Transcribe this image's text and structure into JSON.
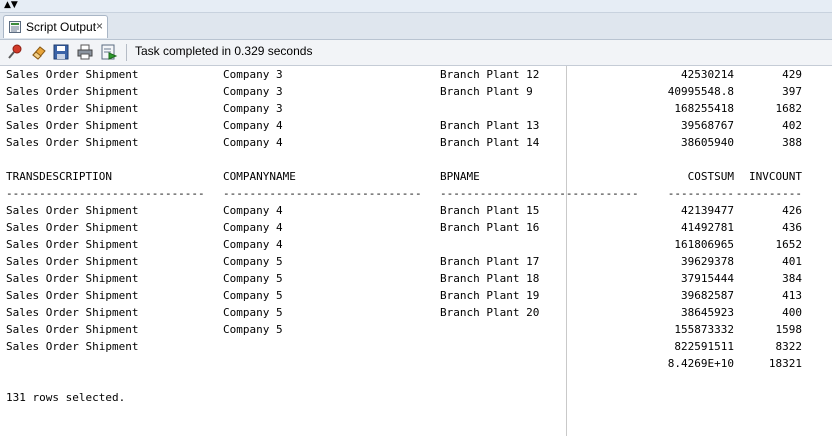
{
  "window": {
    "tab_title": "Script Output",
    "tab_close": "×",
    "collapse_icon": "▲▼"
  },
  "toolbar": {
    "buttons": [
      "pin-icon",
      "eraser-icon",
      "save-icon",
      "print-icon",
      "run-script-icon"
    ],
    "status": "Task completed in 0.329 seconds"
  },
  "output": {
    "header": {
      "c1": "TRANSDESCRIPTION",
      "c2": "COMPANYNAME",
      "c3": "BPNAME",
      "c4": "COSTSUM",
      "c5": "INVCOUNT"
    },
    "dashes": {
      "c1": "------------------------------",
      "c2": "------------------------------",
      "c3": "------------------------------",
      "c4": "----------",
      "c5": "----------"
    },
    "rows_before": [
      {
        "c1": "Sales Order Shipment",
        "c2": "Company 3",
        "c3": "Branch Plant 12",
        "c4": "42530214",
        "c5": "429"
      },
      {
        "c1": "Sales Order Shipment",
        "c2": "Company 3",
        "c3": "Branch Plant 9",
        "c4": "40995548.8",
        "c5": "397"
      },
      {
        "c1": "Sales Order Shipment",
        "c2": "Company 3",
        "c3": "",
        "c4": "168255418",
        "c5": "1682"
      },
      {
        "c1": "Sales Order Shipment",
        "c2": "Company 4",
        "c3": "Branch Plant 13",
        "c4": "39568767",
        "c5": "402"
      },
      {
        "c1": "Sales Order Shipment",
        "c2": "Company 4",
        "c3": "Branch Plant 14",
        "c4": "38605940",
        "c5": "388"
      }
    ],
    "rows_after": [
      {
        "c1": "Sales Order Shipment",
        "c2": "Company 4",
        "c3": "Branch Plant 15",
        "c4": "42139477",
        "c5": "426"
      },
      {
        "c1": "Sales Order Shipment",
        "c2": "Company 4",
        "c3": "Branch Plant 16",
        "c4": "41492781",
        "c5": "436"
      },
      {
        "c1": "Sales Order Shipment",
        "c2": "Company 4",
        "c3": "",
        "c4": "161806965",
        "c5": "1652"
      },
      {
        "c1": "Sales Order Shipment",
        "c2": "Company 5",
        "c3": "Branch Plant 17",
        "c4": "39629378",
        "c5": "401"
      },
      {
        "c1": "Sales Order Shipment",
        "c2": "Company 5",
        "c3": "Branch Plant 18",
        "c4": "37915444",
        "c5": "384"
      },
      {
        "c1": "Sales Order Shipment",
        "c2": "Company 5",
        "c3": "Branch Plant 19",
        "c4": "39682587",
        "c5": "413"
      },
      {
        "c1": "Sales Order Shipment",
        "c2": "Company 5",
        "c3": "Branch Plant 20",
        "c4": "38645923",
        "c5": "400"
      },
      {
        "c1": "Sales Order Shipment",
        "c2": "Company 5",
        "c3": "",
        "c4": "155873332",
        "c5": "1598"
      },
      {
        "c1": "Sales Order Shipment",
        "c2": "",
        "c3": "",
        "c4": "822591511",
        "c5": "8322"
      },
      {
        "c1": "",
        "c2": "",
        "c3": "",
        "c4": "8.4269E+10",
        "c5": "18321"
      }
    ],
    "footer": "131 rows selected."
  }
}
